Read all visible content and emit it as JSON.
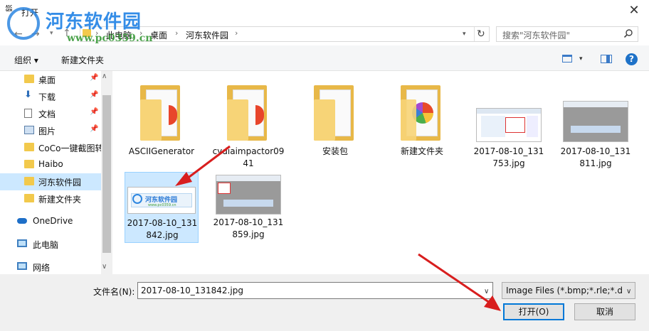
{
  "window": {
    "app_icon_text": "ASC\nGEN",
    "title": "打开",
    "close_glyph": "✕",
    "watermark_name": "河东软件园",
    "watermark_url": "www.pc0359.cn"
  },
  "address": {
    "crumbs": [
      "此电脑",
      "桌面",
      "河东软件园"
    ],
    "refresh_glyph": "↻",
    "search_placeholder": "搜索\"河东软件园\""
  },
  "toolbar": {
    "organize_label": "组织 ▾",
    "new_folder_label": "新建文件夹",
    "help_label": "?"
  },
  "nav": {
    "items": [
      {
        "label": "桌面",
        "pinned": true
      },
      {
        "label": "下载",
        "pinned": true
      },
      {
        "label": "文档",
        "pinned": true
      },
      {
        "label": "图片",
        "pinned": true
      },
      {
        "label": "CoCo一键截图转",
        "pinned": false
      },
      {
        "label": "Haibo",
        "pinned": false
      },
      {
        "label": "河东软件园",
        "pinned": false,
        "selected": true
      },
      {
        "label": "新建文件夹",
        "pinned": false
      }
    ],
    "roots": [
      {
        "label": "OneDrive"
      },
      {
        "label": "此电脑"
      },
      {
        "label": "网络"
      }
    ]
  },
  "files": [
    {
      "name": "ASCIIGenerator",
      "kind": "folder"
    },
    {
      "name": "cydiaimpactor0941",
      "kind": "folder"
    },
    {
      "name": "安装包",
      "kind": "folder"
    },
    {
      "name": "新建文件夹",
      "kind": "folder"
    },
    {
      "name": "2017-08-10_131753.jpg",
      "kind": "image"
    },
    {
      "name": "2017-08-10_131811.jpg",
      "kind": "image"
    },
    {
      "name": "2017-08-10_131842.jpg",
      "kind": "image",
      "selected": true
    },
    {
      "name": "2017-08-10_131859.jpg",
      "kind": "image"
    }
  ],
  "thumb_text": {
    "logo_name": "河东软件园",
    "logo_url": "www.pc0359.cn"
  },
  "footer": {
    "filename_label": "文件名(N):",
    "filename_value": "2017-08-10_131842.jpg",
    "filetype_value": "Image Files (*.bmp;*.rle;*.dib",
    "open_label": "打开(O)",
    "cancel_label": "取消"
  },
  "colors": {
    "selection": "#cce8ff",
    "accent": "#0078d7",
    "folder": "#f2c94c",
    "annotation_arrow": "#d81e1e"
  }
}
